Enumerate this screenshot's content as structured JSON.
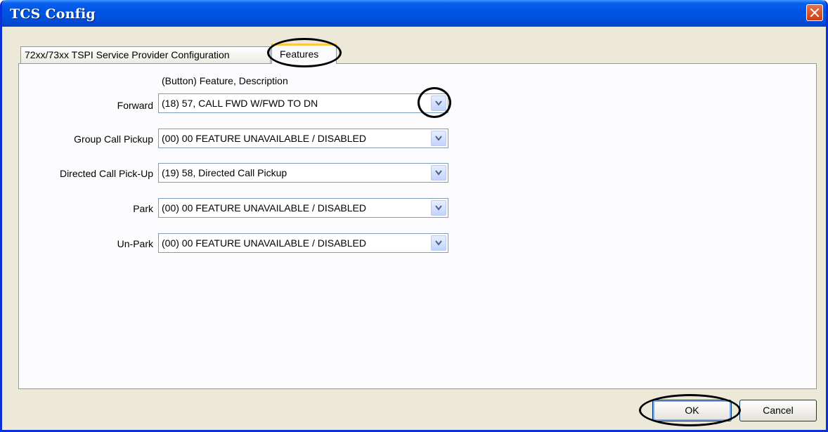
{
  "window": {
    "title": "TCS Config"
  },
  "tabs": [
    {
      "label": "72xx/73xx TSPI Service Provider Configuration"
    },
    {
      "label": "Features"
    }
  ],
  "features": {
    "column_header": "(Button) Feature,  Description",
    "rows": [
      {
        "label": "Forward",
        "value": "(18) 57, CALL FWD W/FWD TO DN"
      },
      {
        "label": "Group Call Pickup",
        "value": "(00) 00 FEATURE UNAVAILABLE / DISABLED"
      },
      {
        "label": "Directed Call Pick-Up",
        "value": "(19) 58, Directed Call Pickup"
      },
      {
        "label": "Park",
        "value": "(00) 00 FEATURE UNAVAILABLE / DISABLED"
      },
      {
        "label": "Un-Park",
        "value": "(00) 00 FEATURE UNAVAILABLE / DISABLED"
      }
    ]
  },
  "buttons": {
    "ok": "OK",
    "cancel": "Cancel"
  },
  "colors": {
    "titlebar": "#0054e3",
    "dialog_bg": "#ece9d8",
    "active_tab_accent": "#ffc83c",
    "highlight_ring": "#000000"
  }
}
